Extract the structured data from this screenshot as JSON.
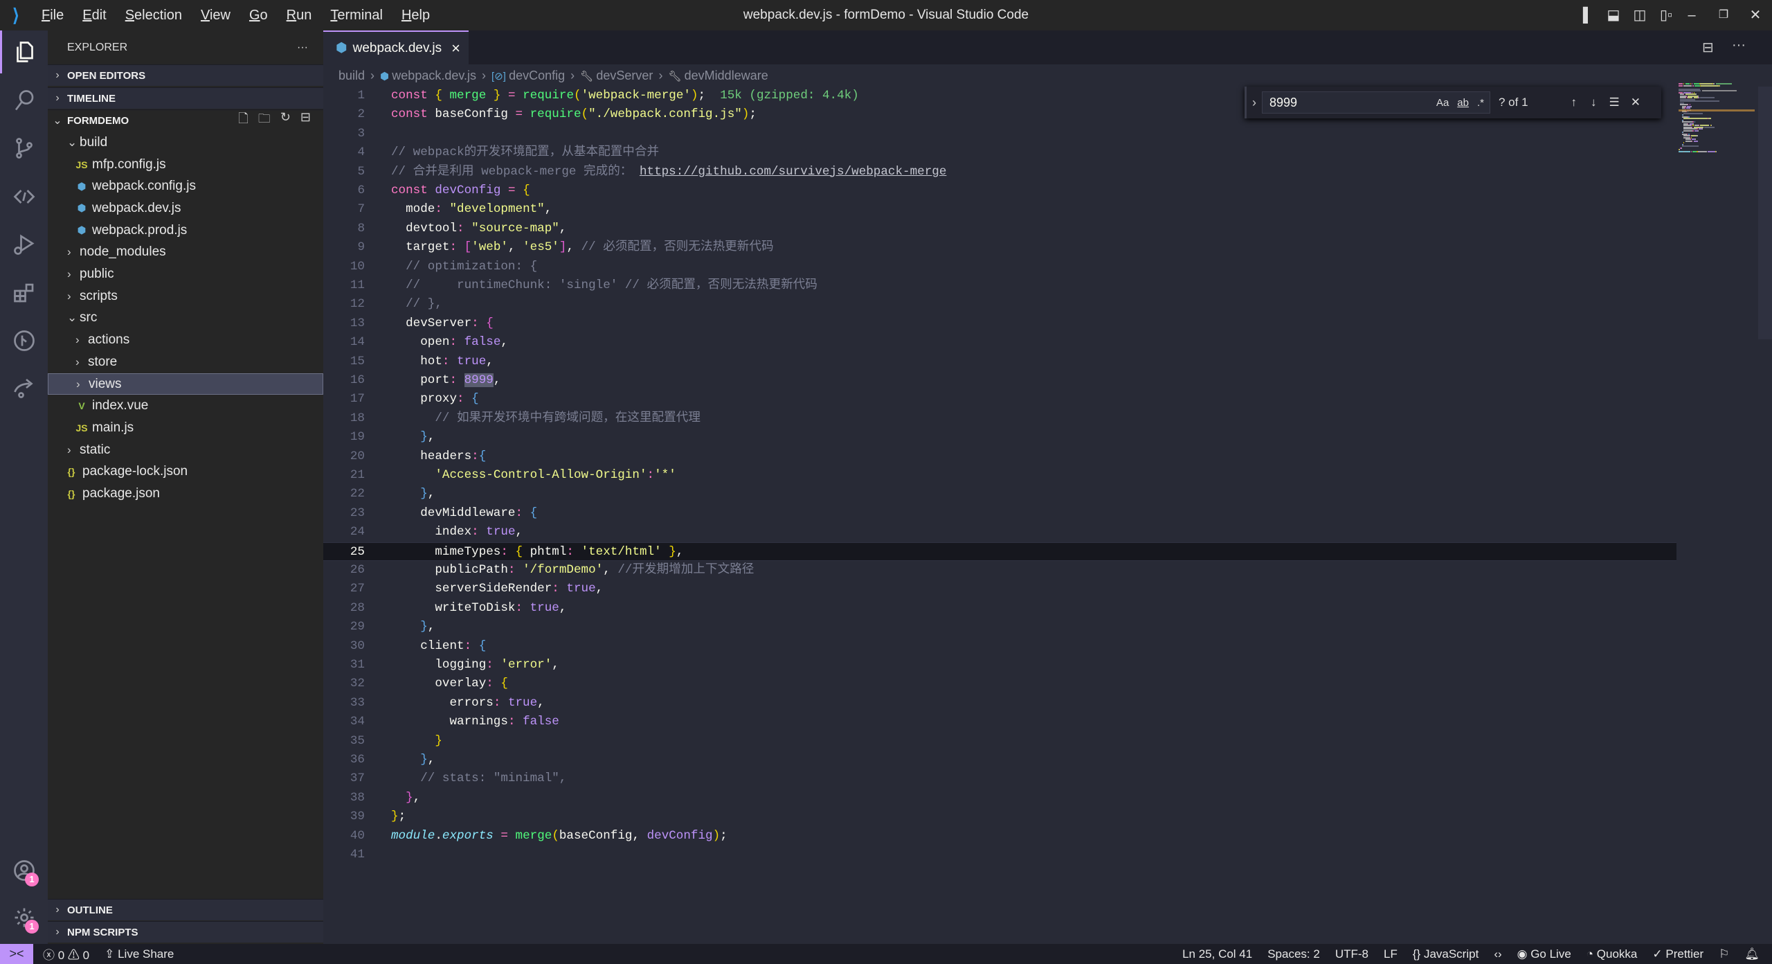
{
  "window": {
    "title": "webpack.dev.js - formDemo - Visual Studio Code"
  },
  "menu": [
    "File",
    "Edit",
    "Selection",
    "View",
    "Go",
    "Run",
    "Terminal",
    "Help"
  ],
  "sidebar": {
    "title": "EXPLORER",
    "more": "···",
    "sections": {
      "open_editors": "OPEN EDITORS",
      "timeline": "TIMELINE",
      "project": "FORMDEMO",
      "outline": "OUTLINE",
      "npm": "NPM SCRIPTS"
    },
    "tree": [
      {
        "label": "build",
        "kind": "folder-open",
        "depth": 1
      },
      {
        "label": "mfp.config.js",
        "kind": "js",
        "depth": 2
      },
      {
        "label": "webpack.config.js",
        "kind": "webpack",
        "depth": 2
      },
      {
        "label": "webpack.dev.js",
        "kind": "webpack",
        "depth": 2
      },
      {
        "label": "webpack.prod.js",
        "kind": "webpack",
        "depth": 2
      },
      {
        "label": "node_modules",
        "kind": "folder",
        "depth": 1
      },
      {
        "label": "public",
        "kind": "folder",
        "depth": 1
      },
      {
        "label": "scripts",
        "kind": "folder",
        "depth": 1
      },
      {
        "label": "src",
        "kind": "folder-open",
        "depth": 1
      },
      {
        "label": "actions",
        "kind": "folder",
        "depth": 2
      },
      {
        "label": "store",
        "kind": "folder",
        "depth": 2
      },
      {
        "label": "views",
        "kind": "folder",
        "depth": 2,
        "selected": true
      },
      {
        "label": "index.vue",
        "kind": "vue",
        "depth": 2
      },
      {
        "label": "main.js",
        "kind": "js",
        "depth": 2
      },
      {
        "label": "static",
        "kind": "folder",
        "depth": 1
      },
      {
        "label": "package-lock.json",
        "kind": "json",
        "depth": 1
      },
      {
        "label": "package.json",
        "kind": "json",
        "depth": 1
      }
    ]
  },
  "activity": {
    "account_badge": "1",
    "settings_badge": "1"
  },
  "tab": {
    "label": "webpack.dev.js",
    "close": "×"
  },
  "breadcrumb": [
    "build",
    "webpack.dev.js",
    "devConfig",
    "devServer",
    "devMiddleware"
  ],
  "find": {
    "value": "8999",
    "case": "Aa",
    "word": "ab",
    "regex": ".*",
    "count": "? of 1"
  },
  "editor": {
    "current_line": 25,
    "lines": [
      [
        [
          "k",
          "const"
        ],
        [
          "v",
          " "
        ],
        [
          "y",
          "{"
        ],
        [
          "v",
          " "
        ],
        [
          "f",
          "merge"
        ],
        [
          "v",
          " "
        ],
        [
          "y",
          "}"
        ],
        [
          "v",
          " "
        ],
        [
          "p",
          "="
        ],
        [
          "v",
          " "
        ],
        [
          "f",
          "require"
        ],
        [
          "y",
          "("
        ],
        [
          "s",
          "'webpack-merge'"
        ],
        [
          "y",
          ")"
        ],
        [
          "v",
          ";  "
        ],
        [
          "h",
          "15k (gzipped: 4.4k)"
        ]
      ],
      [
        [
          "k",
          "const"
        ],
        [
          "v",
          " baseConfig "
        ],
        [
          "p",
          "="
        ],
        [
          "v",
          " "
        ],
        [
          "f",
          "require"
        ],
        [
          "y",
          "("
        ],
        [
          "s",
          "\"./webpack.config.js\""
        ],
        [
          "y",
          ")"
        ],
        [
          "v",
          ";"
        ]
      ],
      [],
      [
        [
          "c",
          "// webpack的开发环境配置，从基本配置中合并"
        ]
      ],
      [
        [
          "c",
          "// 合并是利用 webpack-merge 完成的： "
        ],
        [
          "u",
          "https://github.com/survivejs/webpack-merge"
        ]
      ],
      [
        [
          "k",
          "const"
        ],
        [
          "v",
          " "
        ],
        [
          "b",
          "devConfig"
        ],
        [
          "v",
          " "
        ],
        [
          "p",
          "="
        ],
        [
          "v",
          " "
        ],
        [
          "y",
          "{"
        ]
      ],
      [
        [
          "v",
          "  mode"
        ],
        [
          "p",
          ":"
        ],
        [
          "v",
          " "
        ],
        [
          "s",
          "\"development\""
        ],
        [
          "v",
          ","
        ]
      ],
      [
        [
          "v",
          "  devtool"
        ],
        [
          "p",
          ":"
        ],
        [
          "v",
          " "
        ],
        [
          "s",
          "\"source-map\""
        ],
        [
          "v",
          ","
        ]
      ],
      [
        [
          "v",
          "  target"
        ],
        [
          "p",
          ":"
        ],
        [
          "v",
          " "
        ],
        [
          "m",
          "["
        ],
        [
          "s",
          "'web'"
        ],
        [
          "v",
          ", "
        ],
        [
          "s",
          "'es5'"
        ],
        [
          "m",
          "]"
        ],
        [
          "v",
          ", "
        ],
        [
          "c",
          "// 必须配置，否则无法热更新代码"
        ]
      ],
      [
        [
          "v",
          "  "
        ],
        [
          "c",
          "// optimization: {"
        ]
      ],
      [
        [
          "v",
          "  "
        ],
        [
          "c",
          "//     runtimeChunk: 'single' // 必须配置，否则无法热更新代码"
        ]
      ],
      [
        [
          "v",
          "  "
        ],
        [
          "c",
          "// },"
        ]
      ],
      [
        [
          "v",
          "  devServer"
        ],
        [
          "p",
          ":"
        ],
        [
          "v",
          " "
        ],
        [
          "m",
          "{"
        ]
      ],
      [
        [
          "v",
          "    open"
        ],
        [
          "p",
          ":"
        ],
        [
          "v",
          " "
        ],
        [
          "b",
          "false"
        ],
        [
          "v",
          ","
        ]
      ],
      [
        [
          "v",
          "    hot"
        ],
        [
          "p",
          ":"
        ],
        [
          "v",
          " "
        ],
        [
          "b",
          "true"
        ],
        [
          "v",
          ","
        ]
      ],
      [
        [
          "v",
          "    port"
        ],
        [
          "p",
          ":"
        ],
        [
          "v",
          " "
        ],
        [
          "hl",
          "8999"
        ],
        [
          "v",
          ","
        ]
      ],
      [
        [
          "v",
          "    proxy"
        ],
        [
          "p",
          ":"
        ],
        [
          "v",
          " "
        ],
        [
          "bl",
          "{"
        ]
      ],
      [
        [
          "v",
          "      "
        ],
        [
          "c",
          "// 如果开发环境中有跨域问题，在这里配置代理"
        ]
      ],
      [
        [
          "v",
          "    "
        ],
        [
          "bl",
          "}"
        ],
        [
          "v",
          ","
        ]
      ],
      [
        [
          "v",
          "    headers"
        ],
        [
          "p",
          ":"
        ],
        [
          "bl",
          "{"
        ]
      ],
      [
        [
          "v",
          "      "
        ],
        [
          "s",
          "'Access-Control-Allow-Origin'"
        ],
        [
          "p",
          ":"
        ],
        [
          "s",
          "'*'"
        ]
      ],
      [
        [
          "v",
          "    "
        ],
        [
          "bl",
          "}"
        ],
        [
          "v",
          ","
        ]
      ],
      [
        [
          "v",
          "    devMiddleware"
        ],
        [
          "p",
          ":"
        ],
        [
          "v",
          " "
        ],
        [
          "bl",
          "{"
        ]
      ],
      [
        [
          "v",
          "      index"
        ],
        [
          "p",
          ":"
        ],
        [
          "v",
          " "
        ],
        [
          "b",
          "true"
        ],
        [
          "v",
          ","
        ]
      ],
      [
        [
          "v",
          "      mimeTypes"
        ],
        [
          "p",
          ":"
        ],
        [
          "v",
          " "
        ],
        [
          "y",
          "{"
        ],
        [
          "v",
          " phtml"
        ],
        [
          "p",
          ":"
        ],
        [
          "v",
          " "
        ],
        [
          "s",
          "'text/html'"
        ],
        [
          "v",
          " "
        ],
        [
          "y",
          "}"
        ],
        [
          "v",
          ","
        ]
      ],
      [
        [
          "v",
          "      publicPath"
        ],
        [
          "p",
          ":"
        ],
        [
          "v",
          " "
        ],
        [
          "s",
          "'/formDemo'"
        ],
        [
          "v",
          ", "
        ],
        [
          "c",
          "//开发期增加上下文路径"
        ]
      ],
      [
        [
          "v",
          "      serverSideRender"
        ],
        [
          "p",
          ":"
        ],
        [
          "v",
          " "
        ],
        [
          "b",
          "true"
        ],
        [
          "v",
          ","
        ]
      ],
      [
        [
          "v",
          "      writeToDisk"
        ],
        [
          "p",
          ":"
        ],
        [
          "v",
          " "
        ],
        [
          "b",
          "true"
        ],
        [
          "v",
          ","
        ]
      ],
      [
        [
          "v",
          "    "
        ],
        [
          "bl",
          "}"
        ],
        [
          "v",
          ","
        ]
      ],
      [
        [
          "v",
          "    client"
        ],
        [
          "p",
          ":"
        ],
        [
          "v",
          " "
        ],
        [
          "bl",
          "{"
        ]
      ],
      [
        [
          "v",
          "      logging"
        ],
        [
          "p",
          ":"
        ],
        [
          "v",
          " "
        ],
        [
          "s",
          "'error'"
        ],
        [
          "v",
          ","
        ]
      ],
      [
        [
          "v",
          "      overlay"
        ],
        [
          "p",
          ":"
        ],
        [
          "v",
          " "
        ],
        [
          "y",
          "{"
        ]
      ],
      [
        [
          "v",
          "        errors"
        ],
        [
          "p",
          ":"
        ],
        [
          "v",
          " "
        ],
        [
          "b",
          "true"
        ],
        [
          "v",
          ","
        ]
      ],
      [
        [
          "v",
          "        warnings"
        ],
        [
          "p",
          ":"
        ],
        [
          "v",
          " "
        ],
        [
          "b",
          "false"
        ]
      ],
      [
        [
          "v",
          "      "
        ],
        [
          "y",
          "}"
        ]
      ],
      [
        [
          "v",
          "    "
        ],
        [
          "bl",
          "}"
        ],
        [
          "v",
          ","
        ]
      ],
      [
        [
          "v",
          "    "
        ],
        [
          "c",
          "// stats: \"minimal\","
        ]
      ],
      [
        [
          "v",
          "  "
        ],
        [
          "m",
          "}"
        ],
        [
          "v",
          ","
        ]
      ],
      [
        [
          "y",
          "}"
        ],
        [
          "v",
          ";"
        ]
      ],
      [
        [
          "i",
          "module"
        ],
        [
          "v",
          "."
        ],
        [
          "i",
          "exports"
        ],
        [
          "v",
          " "
        ],
        [
          "p",
          "="
        ],
        [
          "v",
          " "
        ],
        [
          "f",
          "merge"
        ],
        [
          "y",
          "("
        ],
        [
          "v",
          "baseConfig, "
        ],
        [
          "b",
          "devConfig"
        ],
        [
          "y",
          ")"
        ],
        [
          "v",
          ";"
        ]
      ],
      []
    ]
  },
  "status": {
    "remote": "><",
    "errors": "0",
    "warnings": "0",
    "live_share": "Live Share",
    "position": "Ln 25, Col 41",
    "spaces": "Spaces: 2",
    "encoding": "UTF-8",
    "eol": "LF",
    "language": "JavaScript",
    "go_live": "Go Live",
    "quokka": "Quokka",
    "prettier": "Prettier"
  },
  "colors": {
    "accent": "#bd93f9",
    "badge": "#ff79c6",
    "editor_bg": "#282a36"
  }
}
